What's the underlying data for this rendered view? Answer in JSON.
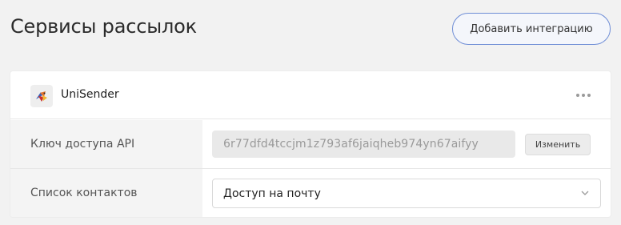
{
  "header": {
    "title": "Сервисы рассылок",
    "add_button_label": "Добавить интеграцию"
  },
  "integration": {
    "service_name": "UniSender",
    "logo_icon": "unisender-logo-icon",
    "more_icon": "more-horizontal-icon",
    "api_key": {
      "label": "Ключ доступа API",
      "value": "6r77dfd4tccjm1z793af6jaiqheb974yn67aifyy",
      "change_button_label": "Изменить"
    },
    "contact_list": {
      "label": "Список контактов",
      "selected": "Доступ на почту",
      "dropdown_icon": "chevron-down-icon"
    }
  },
  "colors": {
    "accent_border": "#6e8dd6",
    "page_background": "#f2f2f2",
    "label_background": "#f4f4f4"
  }
}
